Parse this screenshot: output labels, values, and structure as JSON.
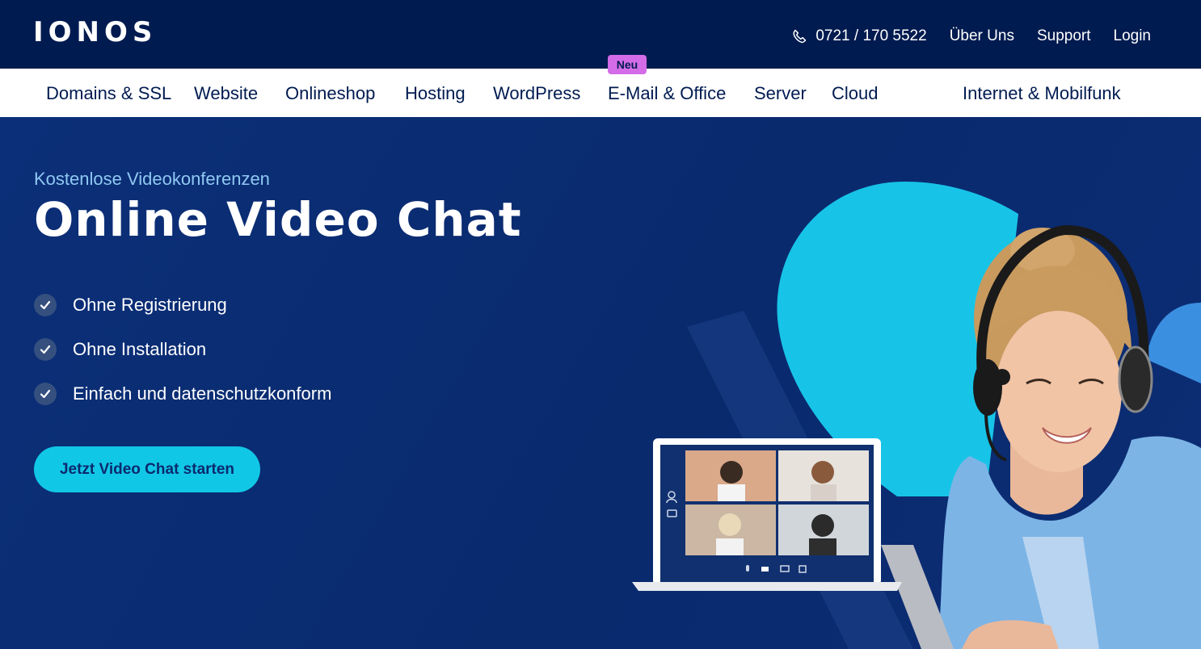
{
  "header": {
    "logo": "IONOS",
    "phone": "0721 / 170 5522",
    "links": [
      "Über Uns",
      "Support",
      "Login"
    ]
  },
  "nav": {
    "items": [
      "Domains & SSL",
      "Website",
      "Onlineshop",
      "Hosting",
      "WordPress",
      "E-Mail & Office",
      "Server",
      "Cloud",
      "Internet & Mobilfunk"
    ],
    "badge": "Neu"
  },
  "hero": {
    "eyebrow": "Kostenlose Videokonferenzen",
    "title": "Online Video Chat",
    "features": [
      "Ohne Registrierung",
      "Ohne Installation",
      "Einfach und datenschutzkonform"
    ],
    "cta": "Jetzt Video Chat starten"
  },
  "colors": {
    "topbar": "#001b50",
    "hero_bg": "#0b2a6f",
    "accent": "#11c7e6",
    "badge": "#d46ce8",
    "eyebrow": "#8fc8f2"
  },
  "icons": [
    "phone-icon",
    "check-icon",
    "user-icon",
    "chat-icon",
    "mic-icon",
    "camera-icon",
    "screen-share-icon",
    "exit-icon"
  ]
}
